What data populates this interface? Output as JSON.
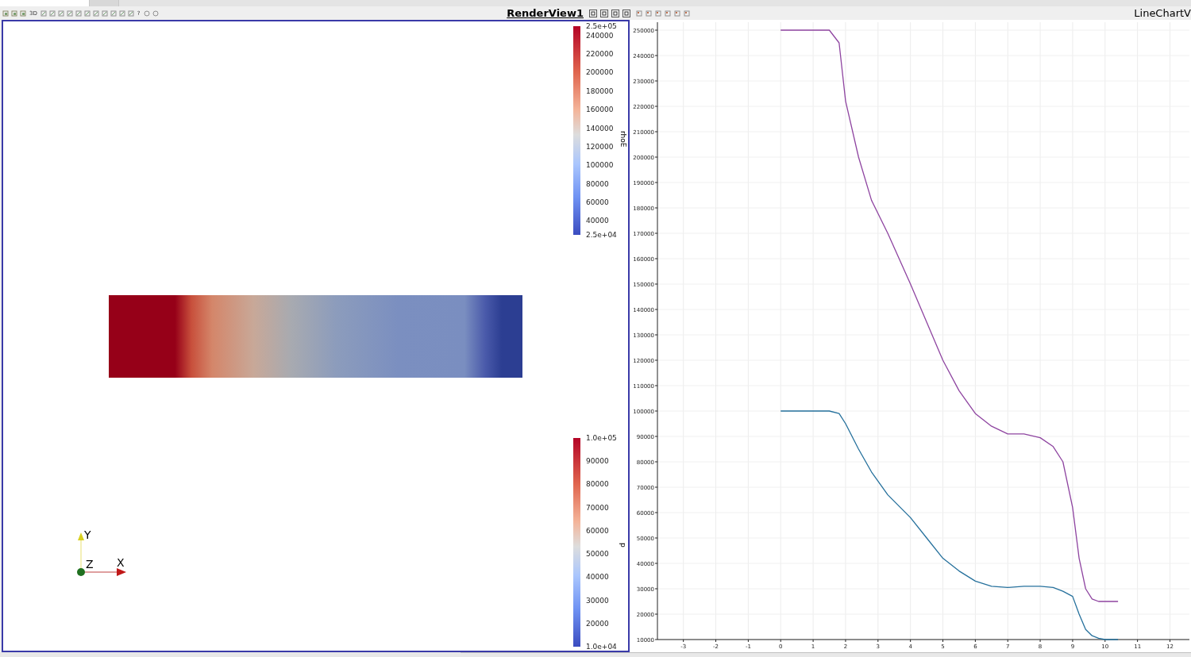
{
  "tabs": [
    {
      "selected": true
    },
    {
      "selected": false
    }
  ],
  "toolbar": {
    "mode_label": "3D",
    "help_label": "?"
  },
  "render_view": {
    "title": "RenderView1",
    "color_legends": [
      {
        "title": "rhoE",
        "labels": [
          "2.5e+05",
          "240000",
          "220000",
          "200000",
          "180000",
          "160000",
          "140000",
          "120000",
          "100000",
          "80000",
          "60000",
          "40000",
          "2.5e+04"
        ]
      },
      {
        "title": "p",
        "labels": [
          "1.0e+05",
          "90000",
          "80000",
          "70000",
          "60000",
          "50000",
          "40000",
          "30000",
          "20000",
          "1.0e+04"
        ]
      }
    ],
    "axes": {
      "x": "X",
      "y": "Y",
      "z": "Z"
    }
  },
  "chart_view": {
    "title": "LineChartV",
    "chart_data": {
      "type": "line",
      "grid": true,
      "x": [
        0,
        0.5,
        1,
        1.5,
        1.8,
        2,
        2.4,
        2.8,
        3.3,
        4,
        4.5,
        5,
        5.5,
        6,
        6.5,
        7,
        7.5,
        8,
        8.4,
        8.7,
        9,
        9.2,
        9.4,
        9.6,
        9.8,
        10,
        10.4
      ],
      "series": [
        {
          "color": "#8e44a0",
          "values": [
            250000,
            250000,
            250000,
            250000,
            245000,
            222000,
            200000,
            183000,
            170000,
            150000,
            135000,
            120000,
            108000,
            99000,
            94000,
            91000,
            91000,
            89500,
            86000,
            80000,
            62000,
            42000,
            30000,
            26000,
            25000,
            25000,
            25000
          ]
        },
        {
          "color": "#25709c",
          "values": [
            100000,
            100000,
            100000,
            100000,
            99000,
            95000,
            85000,
            76000,
            67000,
            58000,
            50000,
            42000,
            37000,
            33000,
            31000,
            30500,
            31000,
            31000,
            30500,
            29000,
            27000,
            20000,
            14000,
            11500,
            10500,
            10000,
            10000
          ]
        }
      ],
      "xlim": [
        -3.8,
        12.6
      ],
      "ylim": [
        10000,
        250000
      ],
      "xticks": [
        -3,
        -2,
        -1,
        0,
        1,
        2,
        3,
        4,
        5,
        6,
        7,
        8,
        9,
        10,
        11,
        12
      ],
      "yticks": [
        10000,
        20000,
        30000,
        40000,
        50000,
        60000,
        70000,
        80000,
        90000,
        100000,
        110000,
        120000,
        130000,
        140000,
        150000,
        160000,
        170000,
        180000,
        190000,
        200000,
        210000,
        220000,
        230000,
        240000,
        250000
      ]
    }
  }
}
